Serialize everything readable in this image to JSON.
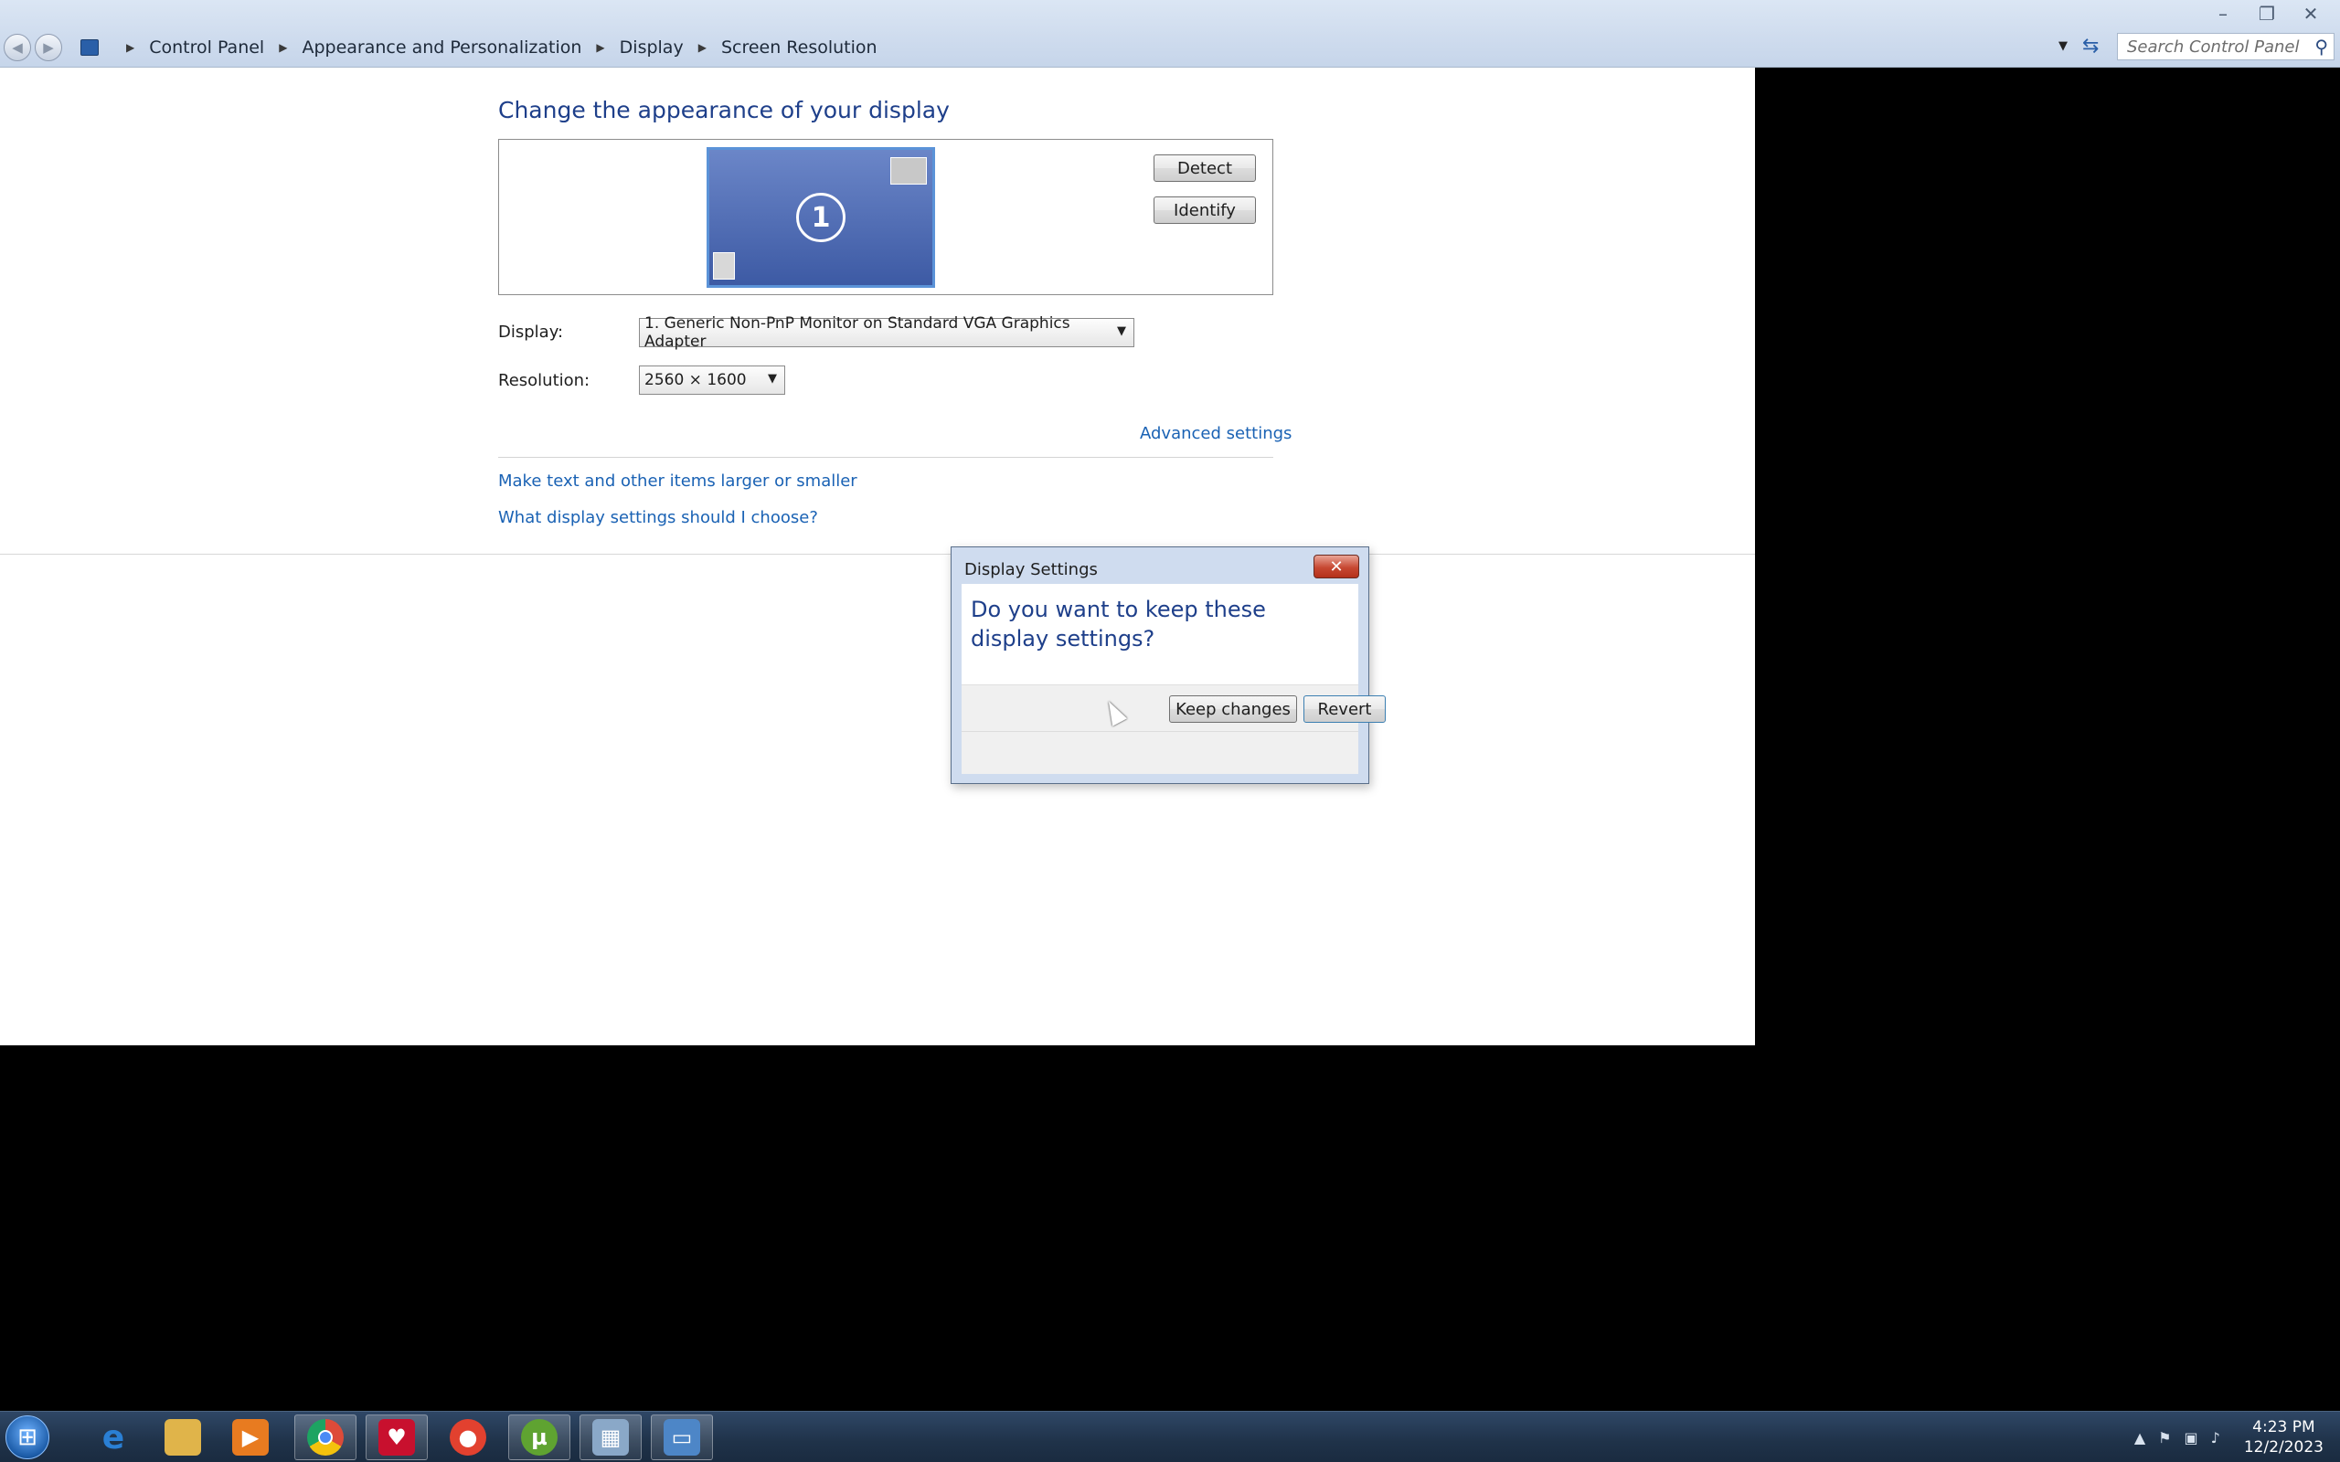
{
  "window": {
    "minimize": "–",
    "restore": "❐",
    "close": "✕"
  },
  "breadcrumb": {
    "items": [
      "Control Panel",
      "Appearance and Personalization",
      "Display",
      "Screen Resolution"
    ]
  },
  "search": {
    "placeholder": "Search Control Panel"
  },
  "main": {
    "title": "Change the appearance of your display",
    "monitor_number": "1",
    "detect_label": "Detect",
    "identify_label": "Identify",
    "display_label": "Display:",
    "display_value": "1. Generic Non-PnP Monitor on Standard VGA Graphics Adapter",
    "resolution_label": "Resolution:",
    "resolution_value": "2560 × 1600",
    "advanced_link": "Advanced settings",
    "text_size_link": "Make text and other items larger or smaller",
    "what_settings_link": "What display settings should I choose?"
  },
  "dialog": {
    "title": "Display Settings",
    "question": "Do you want to keep these display settings?",
    "keep_label": "Keep changes",
    "revert_label": "Revert"
  },
  "taskbar": {
    "apps": [
      {
        "name": "internet-explorer",
        "color": "#2a7fd4"
      },
      {
        "name": "file-explorer",
        "color": "#e0b44a"
      },
      {
        "name": "media-player",
        "color": "#e87b20"
      },
      {
        "name": "chrome",
        "color": "#dd4b39"
      },
      {
        "name": "red-app",
        "color": "#c8102e"
      },
      {
        "name": "vpn-app",
        "color": "#e2412f"
      },
      {
        "name": "utorrent",
        "color": "#5fa331"
      },
      {
        "name": "calculator",
        "color": "#8aa8c8"
      },
      {
        "name": "control-panel",
        "color": "#4d86c7"
      }
    ],
    "time": "4:23 PM",
    "date": "12/2/2023"
  },
  "colors": {
    "accent_title": "#1e3f8a",
    "link": "#1a62b4",
    "taskbar": "#1f3249"
  }
}
